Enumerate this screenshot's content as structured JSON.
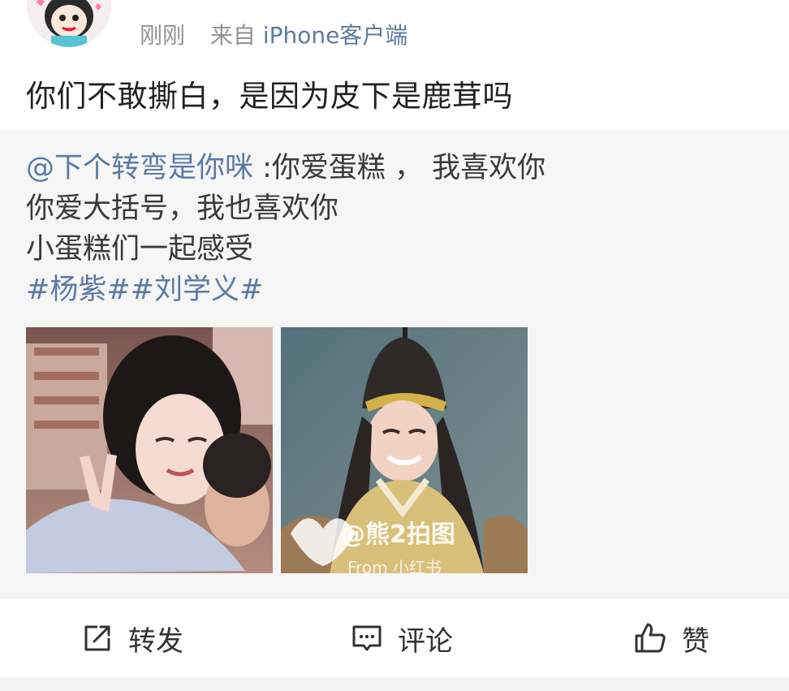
{
  "header": {
    "time": "刚刚",
    "source_prefix": "来自",
    "device": "iPhone客户端"
  },
  "post": {
    "text": "你们不敢撕白，是因为皮下是鹿茸吗"
  },
  "retweet": {
    "mention": "@下个转弯是你咪",
    "line1_rest": " :你爱蛋糕 ， 我喜欢你",
    "line2": "你爱大括号，我也喜欢你",
    "line3": "小蛋糕们一起感受",
    "hashtags": "#杨紫##刘学义#",
    "photos": [
      {
        "watermark": "",
        "watermark_sub": ""
      },
      {
        "watermark": "@熊2拍图",
        "watermark_sub": "From 小红书"
      }
    ]
  },
  "actions": {
    "repost": "转发",
    "comment": "评论",
    "like": "赞"
  },
  "colors": {
    "link": "#5b7aa6",
    "meta": "#939393",
    "retweet_bg": "#f6f6f6"
  }
}
